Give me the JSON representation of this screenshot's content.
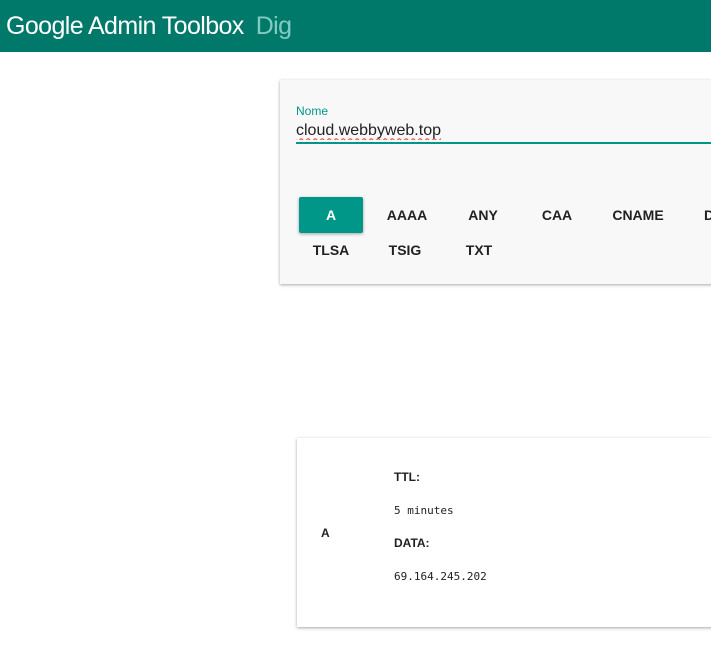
{
  "header": {
    "title": "Google Admin Toolbox",
    "subtitle": "Dig"
  },
  "query": {
    "name_label": "Nome",
    "name_value": "cloud.webbyweb.top",
    "record_types": [
      "A",
      "AAAA",
      "ANY",
      "CAA",
      "CNAME",
      "D",
      "TLSA",
      "TSIG",
      "TXT"
    ],
    "selected_type": "A"
  },
  "result": {
    "record_type": "A",
    "ttl_label": "TTL:",
    "ttl_value": "5 minutes",
    "data_label": "DATA:",
    "data_value": "69.164.245.202"
  },
  "colors": {
    "app_bar": "#00796b",
    "subtitle": "#80cbc4",
    "accent": "#009688"
  }
}
